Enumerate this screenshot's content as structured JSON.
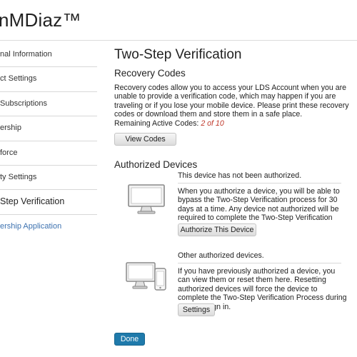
{
  "header": {
    "title": "nMDiaz™"
  },
  "sidebar": {
    "items": [
      {
        "label": "nal Information"
      },
      {
        "label": "ct Settings"
      },
      {
        "label": "Subscriptions"
      },
      {
        "label": "ership"
      },
      {
        "label": "force"
      },
      {
        "label": "ty Settings"
      },
      {
        "label": "Step Verification"
      },
      {
        "label": "ership Application"
      }
    ]
  },
  "main": {
    "title": "Two-Step Verification",
    "recovery": {
      "title": "Recovery Codes",
      "description": "Recovery codes allow you to access your LDS Account when you are unable to provide a verification code, which may happen if you are traveling or if you lose your mobile device. Please print these recovery codes or download them and store them in a safe place.",
      "remaining_label": "Remaining Active Codes:",
      "remaining_count": "2 of 10",
      "view_button": "View Codes"
    },
    "authorized": {
      "title": "Authorized Devices",
      "this_device_status": "This device has not been authorized.",
      "this_device_description": "When you authorize a device, you will be able to bypass the Two-Step Verification process for 30 days at a time. Any device not authorized will be required to complete the Two-Step Verification process.",
      "authorize_button": "Authorize This Device",
      "other_title": "Other authorized devices.",
      "other_description": "If you have previously authorized a device, you can view them or reset them here. Resetting authorized devices will force the device to complete the Two-Step Verification Process during the next sign in.",
      "settings_button": "Settings"
    },
    "done_button": "Done"
  },
  "icons": {
    "monitor": "monitor-icon",
    "devices": "monitor-and-phone-icon"
  },
  "colors": {
    "accent": "#1f7aab",
    "link": "#3d72b0",
    "remaining_count": "#c0392b"
  }
}
